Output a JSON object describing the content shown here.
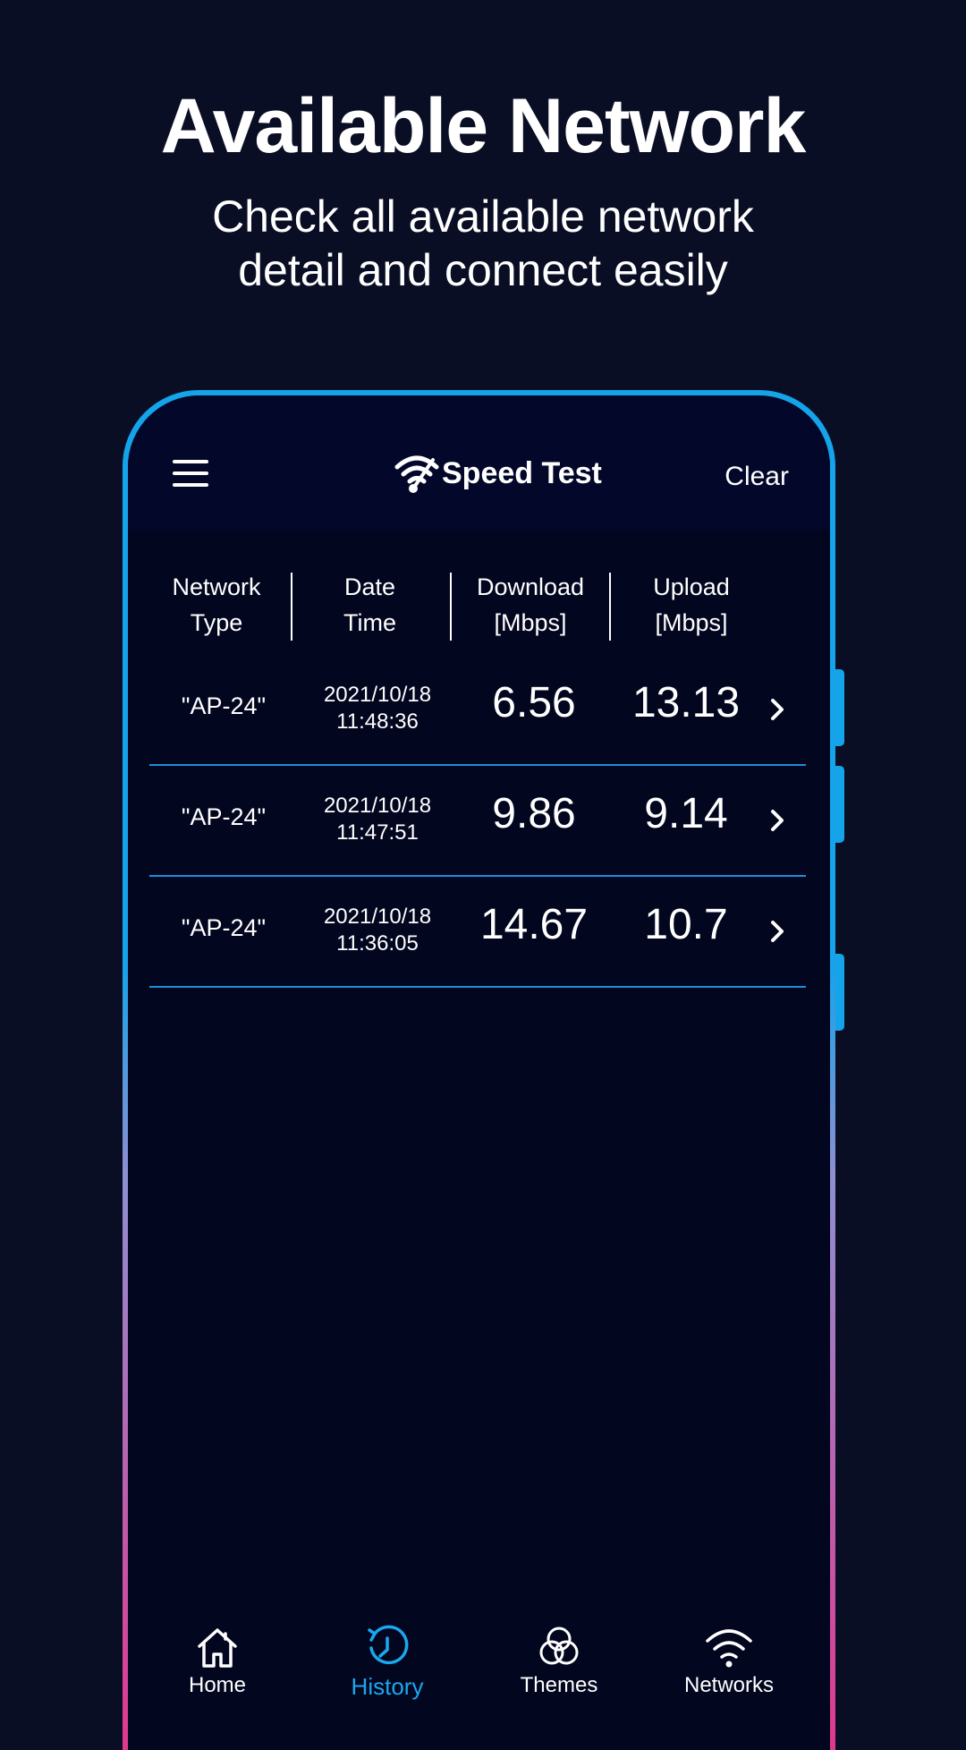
{
  "promo": {
    "title": "Available Network",
    "subtitle": "Check all available network detail and connect easily"
  },
  "header": {
    "menu_icon": "hamburger-icon",
    "app_title": "Speed Test",
    "clear_label": "Clear"
  },
  "table": {
    "columns": [
      {
        "line1": "Network",
        "line2": "Type"
      },
      {
        "line1": "Date",
        "line2": "Time"
      },
      {
        "line1": "Download",
        "line2": "[Mbps]"
      },
      {
        "line1": "Upload",
        "line2": "[Mbps]"
      }
    ],
    "rows": [
      {
        "network": "\"AP-24\"",
        "date": "2021/10/18",
        "time": "11:48:36",
        "download": "6.56",
        "upload": "13.13"
      },
      {
        "network": "\"AP-24\"",
        "date": "2021/10/18",
        "time": "11:47:51",
        "download": "9.86",
        "upload": "9.14"
      },
      {
        "network": "\"AP-24\"",
        "date": "2021/10/18",
        "time": "11:36:05",
        "download": "14.67",
        "upload": "10.7"
      }
    ]
  },
  "nav": {
    "items": [
      {
        "label": "Home",
        "icon": "home-icon",
        "active": false
      },
      {
        "label": "History",
        "icon": "history-icon",
        "active": true
      },
      {
        "label": "Themes",
        "icon": "themes-icon",
        "active": false
      },
      {
        "label": "Networks",
        "icon": "wifi-icon",
        "active": false
      }
    ]
  },
  "colors": {
    "background": "#0a0e24",
    "screen": "#02061f",
    "accent": "#15a3ea",
    "gradient_end": "#e0388e",
    "row_divider": "#1d8fd6"
  }
}
